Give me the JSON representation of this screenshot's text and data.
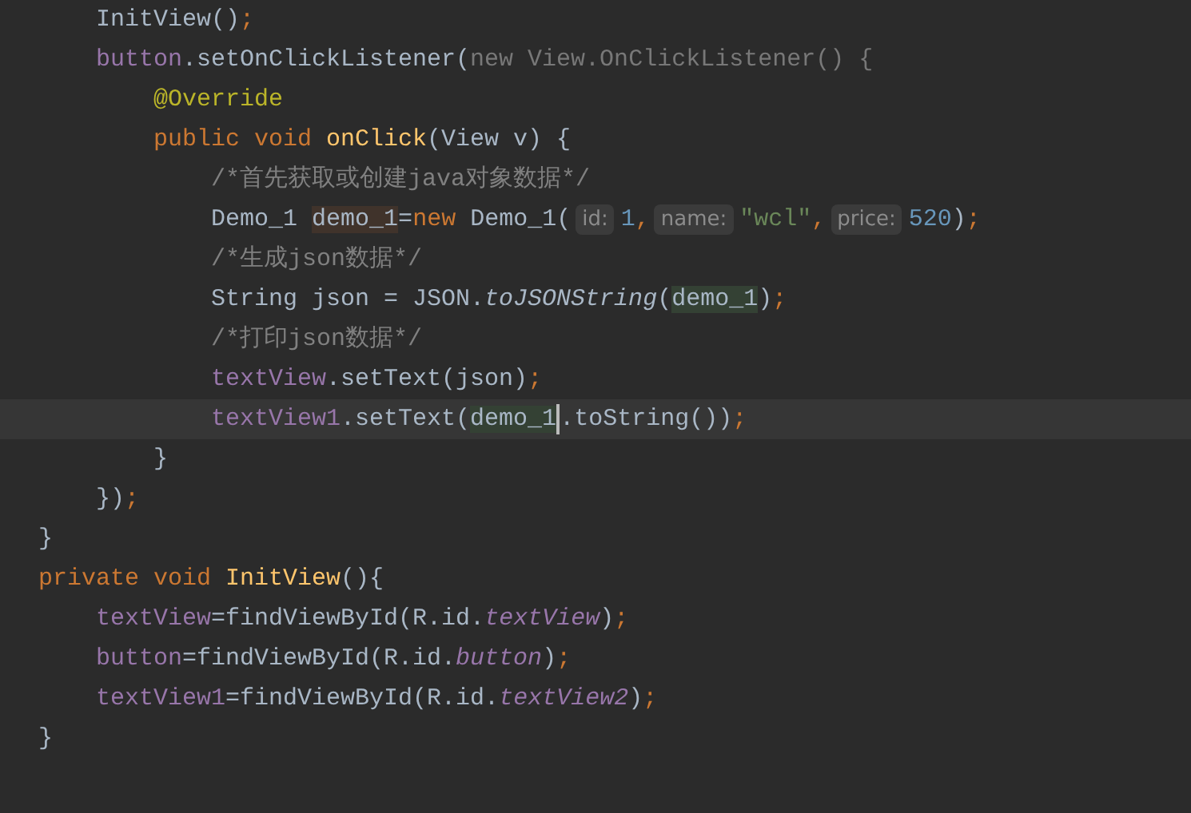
{
  "lines": [
    {
      "tokens": [
        {
          "text": "    InitView()",
          "kind": "plain"
        },
        {
          "text": ";",
          "kind": "keyword"
        }
      ]
    },
    {
      "tokens": [
        {
          "text": "    button",
          "kind": "field"
        },
        {
          "text": ".setOnClickListener(",
          "kind": "plain"
        },
        {
          "text": "new View.OnClickListener() {",
          "kind": "dim"
        }
      ]
    },
    {
      "tokens": [
        {
          "text": "        @Override",
          "kind": "annotation"
        }
      ]
    },
    {
      "tokens": [
        {
          "text": "        public void ",
          "kind": "keyword"
        },
        {
          "text": "onClick",
          "kind": "method"
        },
        {
          "text": "(View v) {",
          "kind": "plain"
        }
      ]
    },
    {
      "tokens": [
        {
          "text": "            /*首先获取或创建java对象数据*/",
          "kind": "comment"
        }
      ]
    },
    {
      "tokens": [
        {
          "text": "            Demo_1 ",
          "kind": "plain"
        },
        {
          "text": "demo_1",
          "kind": "plain",
          "highlighted": true,
          "write": true
        },
        {
          "text": "=",
          "kind": "plain"
        },
        {
          "text": "new",
          "kind": "keyword"
        },
        {
          "text": " Demo_1(",
          "kind": "plain"
        },
        {
          "text": "id:",
          "kind": "hint"
        },
        {
          "text": "1",
          "kind": "number"
        },
        {
          "text": ",",
          "kind": "keyword"
        },
        {
          "text": "name:",
          "kind": "hint"
        },
        {
          "text": "\"wcl\"",
          "kind": "string"
        },
        {
          "text": ",",
          "kind": "keyword"
        },
        {
          "text": "price:",
          "kind": "hint"
        },
        {
          "text": "520",
          "kind": "number"
        },
        {
          "text": ")",
          "kind": "plain"
        },
        {
          "text": ";",
          "kind": "keyword"
        }
      ]
    },
    {
      "tokens": [
        {
          "text": "            /*生成json数据*/",
          "kind": "comment"
        }
      ]
    },
    {
      "tokens": [
        {
          "text": "            String json = JSON.",
          "kind": "plain"
        },
        {
          "text": "toJSONString",
          "kind": "italic"
        },
        {
          "text": "(",
          "kind": "plain"
        },
        {
          "text": "demo_1",
          "kind": "plain",
          "highlighted": true,
          "write": false
        },
        {
          "text": ")",
          "kind": "plain"
        },
        {
          "text": ";",
          "kind": "keyword"
        }
      ]
    },
    {
      "tokens": [
        {
          "text": "            /*打印json数据*/",
          "kind": "comment"
        }
      ]
    },
    {
      "tokens": [
        {
          "text": "            textView",
          "kind": "field"
        },
        {
          "text": ".setText(json)",
          "kind": "plain"
        },
        {
          "text": ";",
          "kind": "keyword"
        }
      ]
    },
    {
      "tokens": [
        {
          "text": "            textView1",
          "kind": "field"
        },
        {
          "text": ".setText(",
          "kind": "plain"
        },
        {
          "text": "demo_1",
          "kind": "plain",
          "highlighted": true,
          "write": false,
          "caret_after": true
        },
        {
          "text": ".toString())",
          "kind": "plain"
        },
        {
          "text": ";",
          "kind": "keyword"
        }
      ]
    },
    {
      "tokens": [
        {
          "text": "        }",
          "kind": "plain"
        }
      ]
    },
    {
      "tokens": [
        {
          "text": "    })",
          "kind": "plain"
        },
        {
          "text": ";",
          "kind": "keyword"
        }
      ]
    },
    {
      "tokens": [
        {
          "text": "}",
          "kind": "plain"
        }
      ]
    },
    {
      "tokens": [
        {
          "text": "private void ",
          "kind": "keyword"
        },
        {
          "text": "InitView",
          "kind": "method"
        },
        {
          "text": "(){",
          "kind": "plain"
        }
      ]
    },
    {
      "tokens": [
        {
          "text": "    textView",
          "kind": "field"
        },
        {
          "text": "=findViewById(R.id.",
          "kind": "plain"
        },
        {
          "text": "textView",
          "kind": "field_italic"
        },
        {
          "text": ")",
          "kind": "plain"
        },
        {
          "text": ";",
          "kind": "keyword"
        }
      ]
    },
    {
      "tokens": [
        {
          "text": "    button",
          "kind": "field"
        },
        {
          "text": "=findViewById(R.id.",
          "kind": "plain"
        },
        {
          "text": "button",
          "kind": "field_italic"
        },
        {
          "text": ")",
          "kind": "plain"
        },
        {
          "text": ";",
          "kind": "keyword"
        }
      ]
    },
    {
      "tokens": [
        {
          "text": "    textView1",
          "kind": "field"
        },
        {
          "text": "=findViewById(R.id.",
          "kind": "plain"
        },
        {
          "text": "textView2",
          "kind": "field_italic"
        },
        {
          "text": ")",
          "kind": "plain"
        },
        {
          "text": ";",
          "kind": "keyword"
        }
      ]
    },
    {
      "tokens": [
        {
          "text": "}",
          "kind": "plain"
        }
      ]
    }
  ]
}
